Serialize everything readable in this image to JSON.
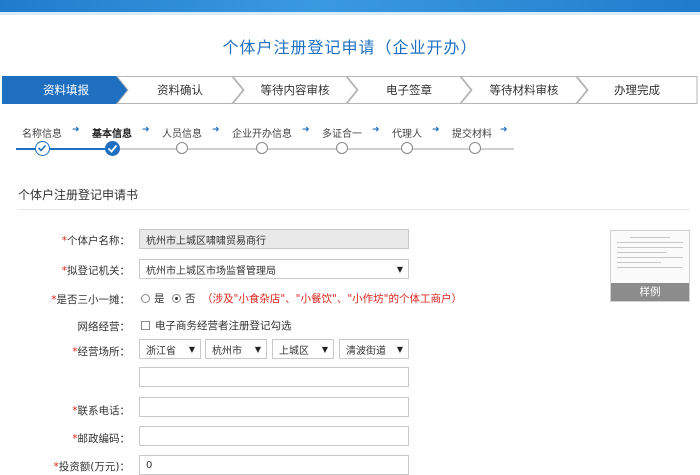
{
  "header": {
    "title": "个体户注册登记申请（企业开办）"
  },
  "steps": [
    {
      "label": "资料填报",
      "active": true
    },
    {
      "label": "资料确认",
      "active": false
    },
    {
      "label": "等待内容审核",
      "active": false
    },
    {
      "label": "电子签章",
      "active": false
    },
    {
      "label": "等待材料审核",
      "active": false
    },
    {
      "label": "办理完成",
      "active": false
    }
  ],
  "substeps": [
    {
      "label": "名称信息",
      "state": "done"
    },
    {
      "label": "基本信息",
      "state": "current"
    },
    {
      "label": "人员信息",
      "state": "todo"
    },
    {
      "label": "企业开办信息",
      "state": "todo"
    },
    {
      "label": "多证合一",
      "state": "todo"
    },
    {
      "label": "代理人",
      "state": "todo"
    },
    {
      "label": "提交材料",
      "state": "todo"
    }
  ],
  "form": {
    "section_title": "个体户注册登记申请书",
    "name": {
      "label": "个体户名称：",
      "value": "杭州市上城区啸啸贸易商行"
    },
    "authority": {
      "label": "拟登记机关：",
      "value": "杭州市上城区市场监督管理局"
    },
    "three_small": {
      "label": "是否三小一摊：",
      "opt_yes": "是",
      "opt_no": "否",
      "selected": "否",
      "hint": "（涉及\"小食杂店\"、\"小餐饮\"、\"小作坊\"的个体工商户）"
    },
    "online": {
      "label": "网络经营：",
      "checkbox_text": "电子商务经营者注册登记勾选"
    },
    "address": {
      "label": "经营场所：",
      "province": "浙江省",
      "city": "杭州市",
      "district": "上城区",
      "street": "清波街道",
      "detail": ""
    },
    "phone": {
      "label": "联系电话：",
      "value": ""
    },
    "postcode": {
      "label": "邮政编码：",
      "value": ""
    },
    "investment": {
      "label": "投资额(万元)：",
      "value": "0"
    }
  },
  "sample": {
    "label": "样例"
  },
  "colors": {
    "primary": "#1e6fc0",
    "required": "#d9251d"
  },
  "icons": {
    "done": "check-icon",
    "caret": "caret-down-icon"
  }
}
